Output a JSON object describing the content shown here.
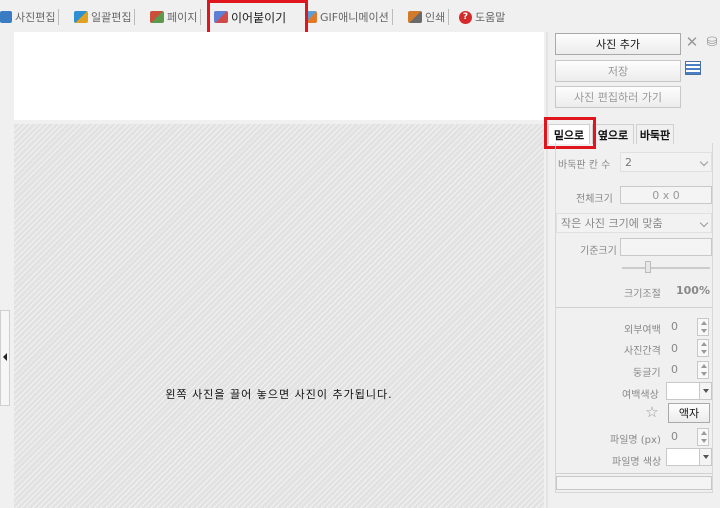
{
  "tabs": [
    {
      "label": "사진편집",
      "icon": "photo-edit-icon",
      "color": "#3a7cc4"
    },
    {
      "label": "일괄편집",
      "icon": "batch-edit-icon",
      "color": "#2f8fd0"
    },
    {
      "label": "페이지",
      "icon": "page-icon",
      "color": "#c94f3a"
    },
    {
      "label": "이어붙이기",
      "icon": "stitch-icon",
      "color": "#5d7fd4",
      "active": true
    },
    {
      "label": "GIF애니메이션",
      "icon": "gif-icon",
      "color": "#5aa0d8"
    },
    {
      "label": "인쇄",
      "icon": "print-icon",
      "color": "#d07a2a"
    },
    {
      "label": "도움말",
      "icon": "help-icon",
      "color": "#d42a2a"
    }
  ],
  "canvas": {
    "message": "왼쪽 사진을 끌어 놓으면 사진이 추가됩니다."
  },
  "side": {
    "add_photo": "사진 추가",
    "save": "저장",
    "go_edit": "사진 편집하러 가기",
    "icons": {
      "clear": "x-icon",
      "trash": "trash-icon",
      "layout": "layout-list-icon"
    }
  },
  "layout_tabs": [
    "밑으로",
    "옆으로",
    "바둑판"
  ],
  "settings": {
    "grid_cols_label": "바둑판 칸 수",
    "grid_cols_value": "2",
    "total_size_label": "전체크기",
    "total_size_value": "0 x 0",
    "fit_option": "작은 사진 크기에 맞춤",
    "base_size_label": "기준크기",
    "scale_label": "크기조절",
    "scale_value": "100%",
    "outer_margin_label": "외부여백",
    "outer_margin_value": "0",
    "photo_gap_label": "사진간격",
    "photo_gap_value": "0",
    "round_label": "둥글기",
    "round_value": "0",
    "margin_color_label": "여백색상",
    "frame_button": "액자",
    "filename_px_label": "파일명 (px)",
    "filename_px_value": "0",
    "filename_color_label": "파일명 색상"
  },
  "colors": {
    "highlight": "#e0161f",
    "margin_color": "#ffffff",
    "filename_color": "#ffffff"
  }
}
